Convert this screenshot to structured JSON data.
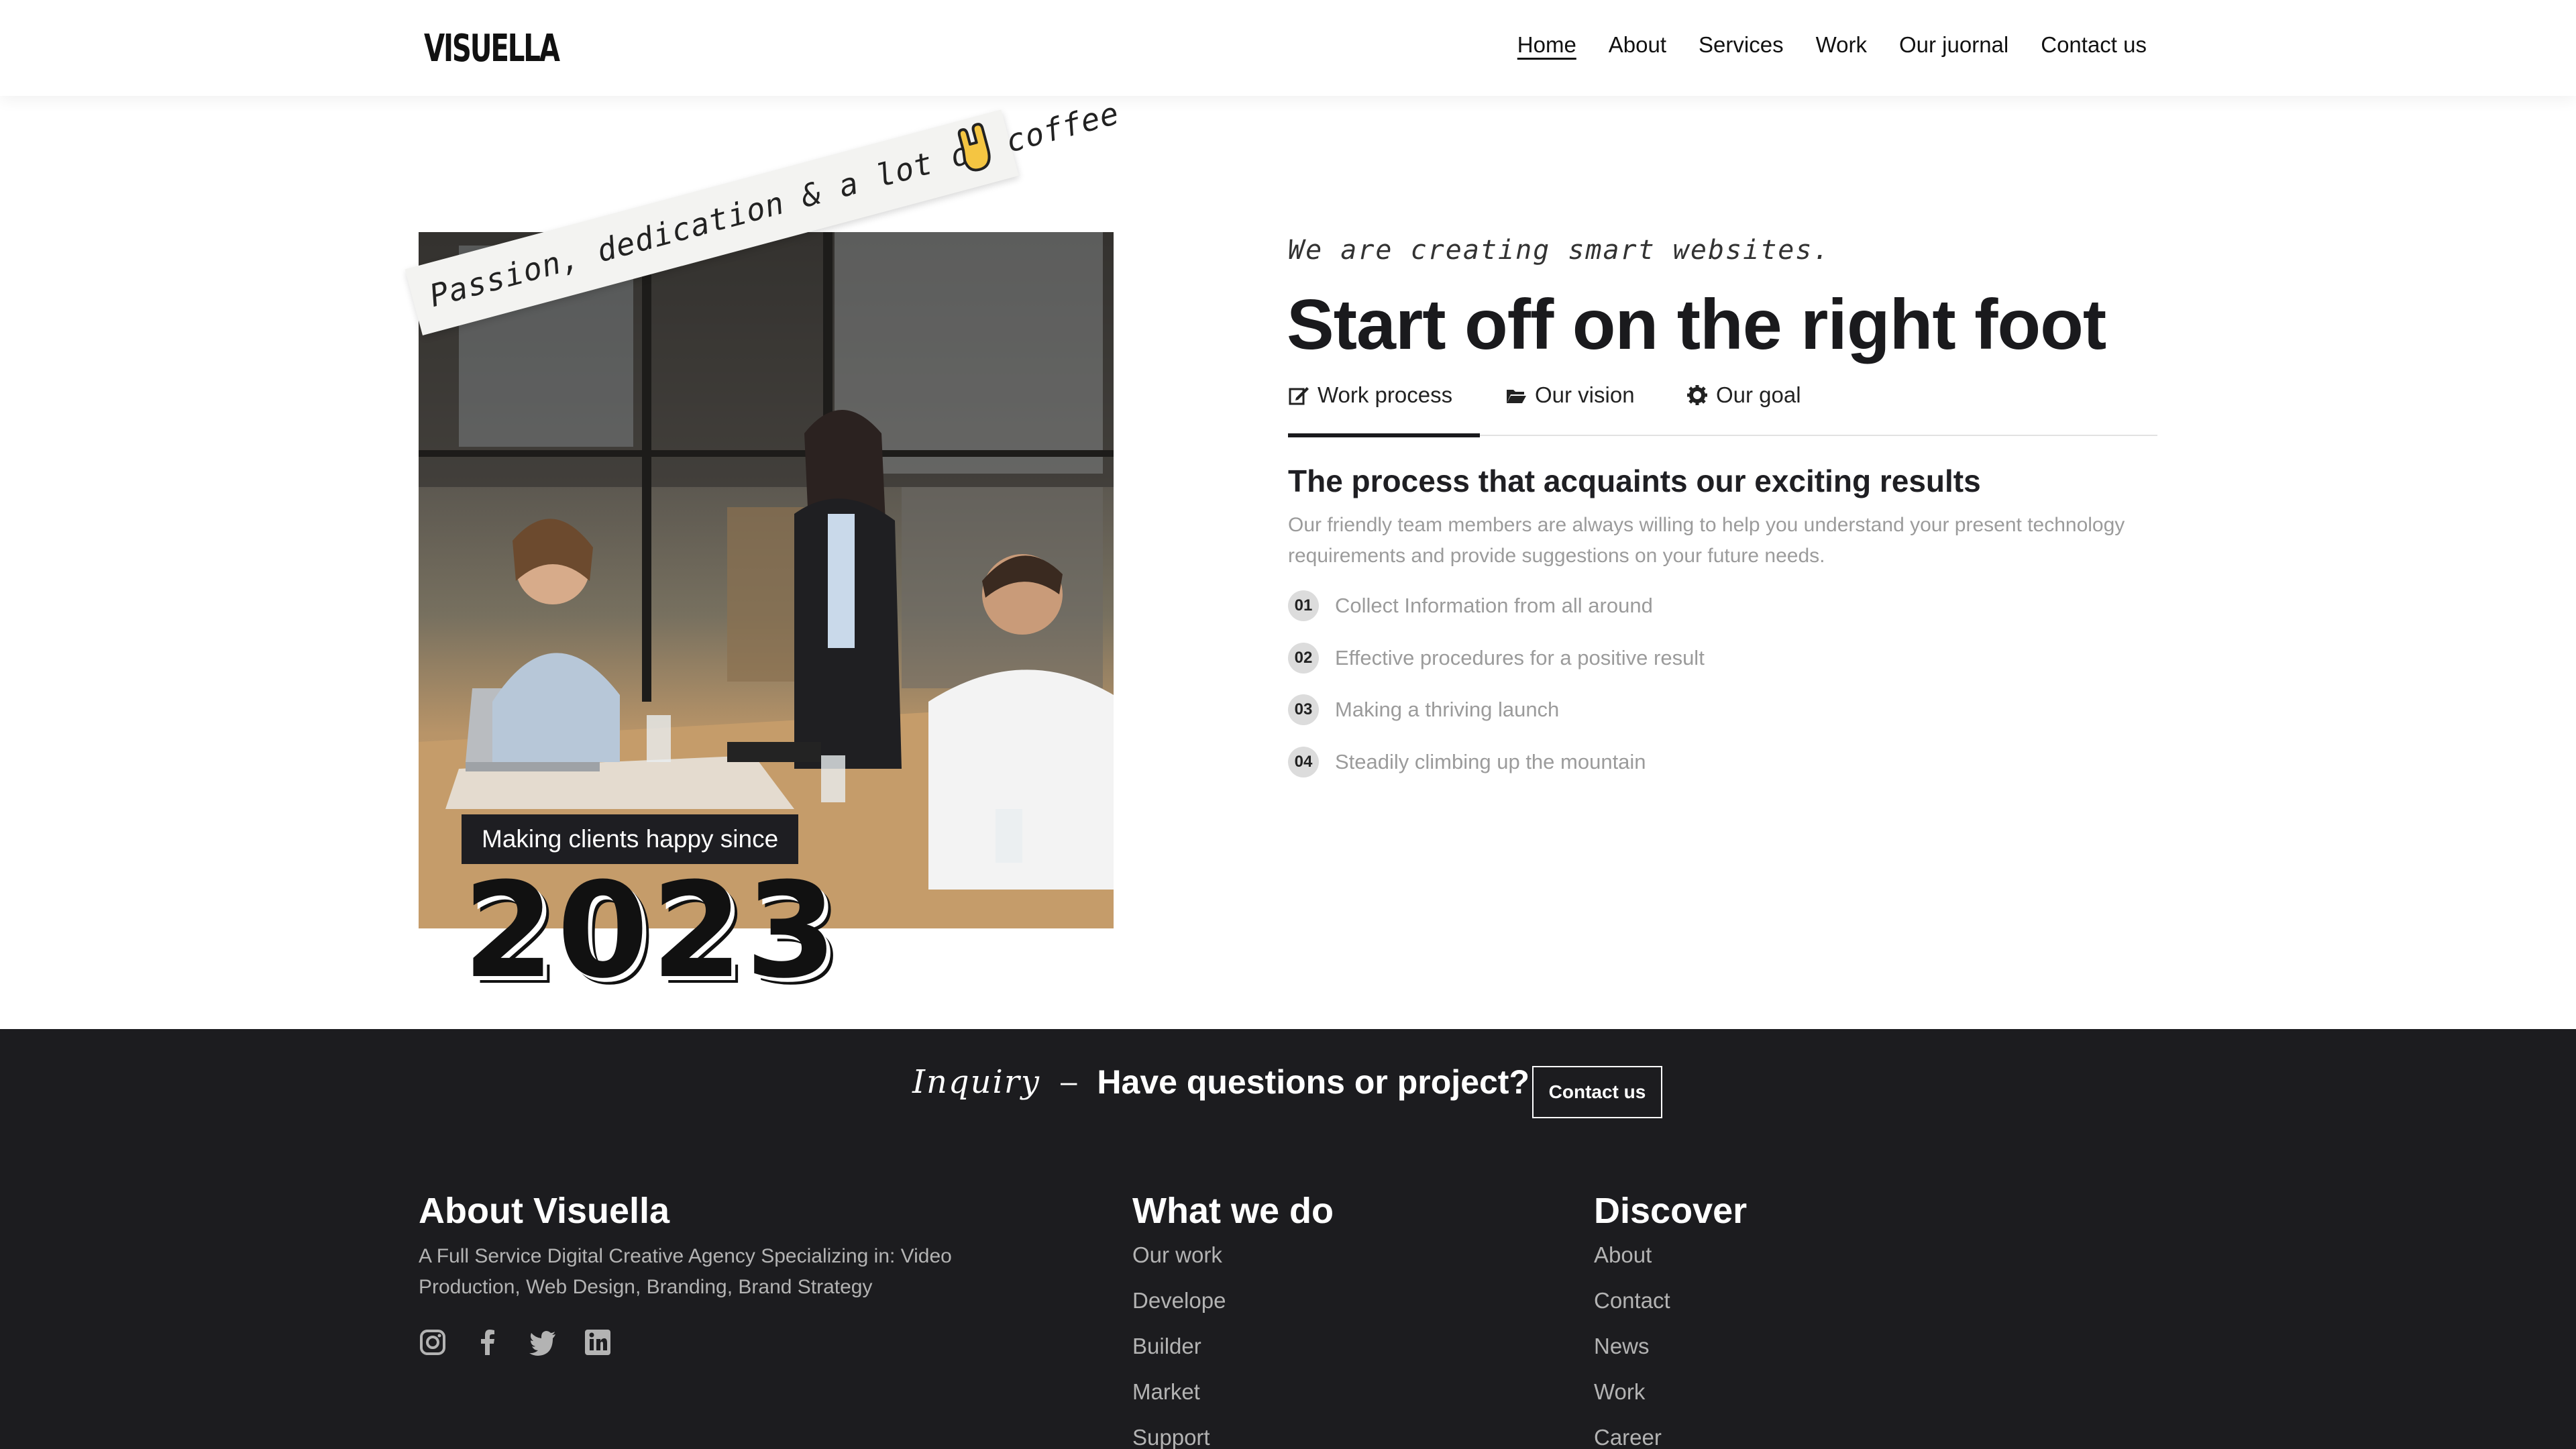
{
  "header": {
    "logo": "VISUELLA",
    "nav": [
      "Home",
      "About",
      "Services",
      "Work",
      "Our juornal",
      "Contact us"
    ],
    "active_nav": "Home"
  },
  "hero": {
    "sticker_text": "Passion, dedication & a lot of coffee",
    "sticker_icon": "rock-hand-icon",
    "badge": "Making clients happy since",
    "year": "2023",
    "kicker": "We are creating smart websites.",
    "title": "Start off on the right foot",
    "tabs": [
      {
        "label": "Work process",
        "icon": "edit-icon"
      },
      {
        "label": "Our vision",
        "icon": "folder-open-icon"
      },
      {
        "label": "Our goal",
        "icon": "gear-icon"
      }
    ],
    "active_tab": "Work process",
    "process_title": "The process that acquaints our exciting results",
    "process_desc": "Our friendly team members are always willing to help you understand your present technology requirements and provide suggestions on your future needs.",
    "steps": [
      {
        "num": "01",
        "text": "Collect Information from all around"
      },
      {
        "num": "02",
        "text": "Effective procedures for a positive result"
      },
      {
        "num": "03",
        "text": "Making a thriving launch"
      },
      {
        "num": "04",
        "text": "Steadily climbing up the mountain"
      }
    ]
  },
  "footer": {
    "inquiry_script": "Inquiry",
    "inquiry_dash": "–",
    "inquiry_question": "Have questions or project?",
    "inquiry_button": "Contact us",
    "about_title": "About Visuella",
    "about_text": "A Full Service Digital Creative Agency Specializing in: Video Production, Web Design, Branding, Brand Strategy",
    "social": [
      "instagram-icon",
      "facebook-icon",
      "twitter-icon",
      "linkedin-icon"
    ],
    "what_title": "What we do",
    "what_items": [
      "Our work",
      "Develope",
      "Builder",
      "Market",
      "Support"
    ],
    "discover_title": "Discover",
    "discover_items": [
      "About",
      "Contact",
      "News",
      "Work",
      "Career"
    ]
  },
  "colors": {
    "dark": "#1c1c1f",
    "text": "#1a1a1d",
    "muted": "#9b9b9b",
    "step_bg": "#dcdcdc"
  }
}
